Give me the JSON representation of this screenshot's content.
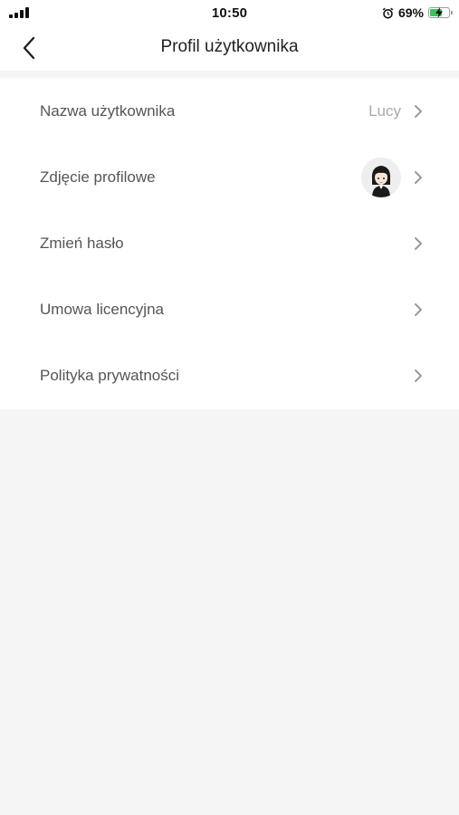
{
  "status_bar": {
    "time": "10:50",
    "battery_percent_label": "69%",
    "battery_level": 0.69,
    "icons": [
      "signal-icon",
      "alarm-icon",
      "battery-icon",
      "charging-bolt-icon"
    ]
  },
  "nav": {
    "title": "Profil użytkownika",
    "back_icon": "chevron-left-icon"
  },
  "menu": {
    "items": [
      {
        "label": "Nazwa użytkownika",
        "value": "Lucy"
      },
      {
        "label": "Zdjęcie profilowe",
        "avatar_icon": "avatar-icon"
      },
      {
        "label": "Zmień hasło"
      },
      {
        "label": "Umowa licencyjna"
      },
      {
        "label": "Polityka prywatności"
      }
    ]
  },
  "colors": {
    "background": "#f5f5f5",
    "surface": "#ffffff",
    "label": "#555555",
    "muted": "#aaaaaa",
    "battery_fill": "#3cc45a"
  }
}
